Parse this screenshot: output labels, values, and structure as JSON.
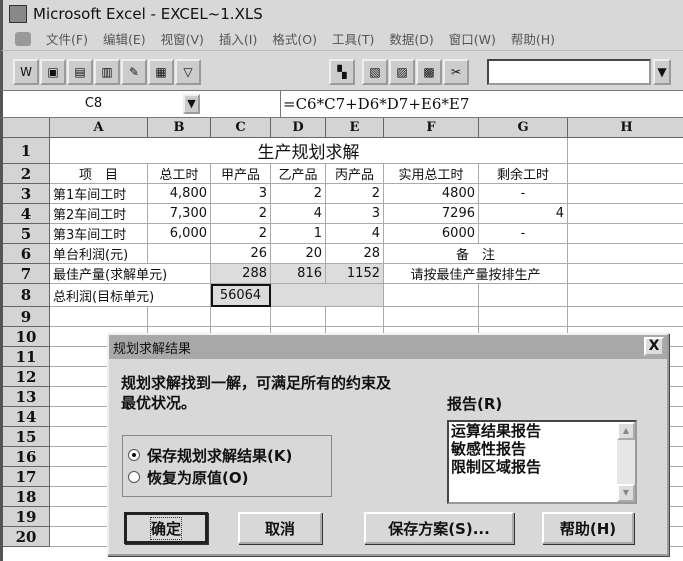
{
  "window": {
    "title": "Microsoft Excel - EXCEL~1.XLS"
  },
  "menu": [
    "文件(F)",
    "编辑(E)",
    "视窗(V)",
    "插入(I)",
    "格式(O)",
    "工具(T)",
    "数据(D)",
    "窗口(W)",
    "帮助(H)"
  ],
  "formula_bar": {
    "name_box": "C8",
    "formula": "=C6*C7+D6*D7+E6*E7"
  },
  "columns": [
    "A",
    "B",
    "C",
    "D",
    "E",
    "F",
    "G",
    "H"
  ],
  "rows": [
    "1",
    "2",
    "3",
    "4",
    "5",
    "6",
    "7",
    "8",
    "9",
    "10",
    "11",
    "12",
    "13",
    "14",
    "15",
    "16",
    "17",
    "18",
    "19",
    "20"
  ],
  "sheet": {
    "title": "生产规划求解",
    "headers": [
      "项　目",
      "总工时",
      "甲产品",
      "乙产品",
      "丙产品",
      "实用总工时",
      "剩余工时"
    ],
    "r3": [
      "第1车间工时",
      "4,800",
      "3",
      "2",
      "2",
      "4800",
      "-"
    ],
    "r4": [
      "第2车间工时",
      "7,300",
      "2",
      "4",
      "3",
      "7296",
      "4"
    ],
    "r5": [
      "第3车间工时",
      "6,000",
      "2",
      "1",
      "4",
      "6000",
      "-"
    ],
    "r6": [
      "单台利润(元)",
      "26",
      "20",
      "28",
      "备　注"
    ],
    "r7": [
      "最佳产量(求解单元)",
      "288",
      "816",
      "1152",
      "请按最佳产量按排生产"
    ],
    "r8": [
      "总利润(目标单元)",
      "56064"
    ]
  },
  "dialog": {
    "title": "规划求解结果",
    "message_line1": "规划求解找到一解，可满足所有的约束及",
    "message_line2": "最优状况。",
    "options": [
      "保存规划求解结果(K)",
      "恢复为原值(O)"
    ],
    "selected_option": 0,
    "report_label": "报告(R)",
    "reports": [
      "运算结果报告",
      "敏感性报告",
      "限制区域报告"
    ],
    "buttons": {
      "ok": "确定",
      "cancel": "取消",
      "save": "保存方案(S)...",
      "help": "帮助(H)"
    },
    "close": "X"
  }
}
